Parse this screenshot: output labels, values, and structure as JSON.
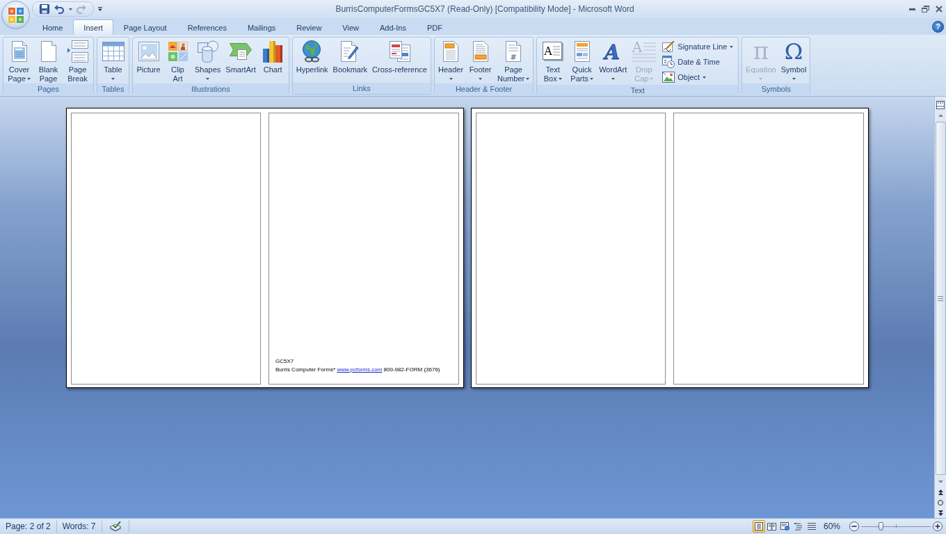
{
  "window": {
    "title": "BurrisComputerFormsGC5X7 (Read-Only) [Compatibility Mode] - Microsoft Word"
  },
  "quick_access": [
    {
      "disabled": false
    },
    {
      "disabled": false
    },
    {
      "disabled": true
    }
  ],
  "tabs": [
    {
      "label": "Home",
      "selected": false
    },
    {
      "label": "Insert",
      "selected": true
    },
    {
      "label": "Page Layout",
      "selected": false
    },
    {
      "label": "References",
      "selected": false
    },
    {
      "label": "Mailings",
      "selected": false
    },
    {
      "label": "Review",
      "selected": false
    },
    {
      "label": "View",
      "selected": false
    },
    {
      "label": "Add-Ins",
      "selected": false
    },
    {
      "label": "PDF",
      "selected": false
    }
  ],
  "help_button": {
    "glyph": "?"
  },
  "ribbon": [
    {
      "label": "Pages",
      "buttons": [
        {
          "kind": "large",
          "lines": [
            "Cover",
            "Page"
          ],
          "dropdown": true,
          "disabled": false
        },
        {
          "kind": "large",
          "lines": [
            "Blank",
            "Page"
          ],
          "dropdown": false,
          "disabled": false
        },
        {
          "kind": "large",
          "lines": [
            "Page",
            "Break"
          ],
          "dropdown": false,
          "disabled": false
        }
      ]
    },
    {
      "label": "Tables",
      "buttons": [
        {
          "kind": "large",
          "lines": [
            "Table"
          ],
          "dropdown": true,
          "disabled": false
        }
      ]
    },
    {
      "label": "Illustrations",
      "buttons": [
        {
          "kind": "large",
          "lines": [
            "Picture"
          ],
          "dropdown": false,
          "disabled": false
        },
        {
          "kind": "large",
          "lines": [
            "Clip",
            "Art"
          ],
          "dropdown": false,
          "disabled": false
        },
        {
          "kind": "large",
          "lines": [
            "Shapes"
          ],
          "dropdown": true,
          "disabled": false
        },
        {
          "kind": "large",
          "lines": [
            "SmartArt"
          ],
          "dropdown": false,
          "disabled": false
        },
        {
          "kind": "large",
          "lines": [
            "Chart"
          ],
          "dropdown": false,
          "disabled": false
        }
      ]
    },
    {
      "label": "Links",
      "buttons": [
        {
          "kind": "large",
          "lines": [
            "Hyperlink"
          ],
          "dropdown": false,
          "disabled": false
        },
        {
          "kind": "large",
          "lines": [
            "Bookmark"
          ],
          "dropdown": false,
          "disabled": false
        },
        {
          "kind": "large",
          "lines": [
            "Cross-reference"
          ],
          "dropdown": false,
          "disabled": false
        }
      ]
    },
    {
      "label": "Header & Footer",
      "buttons": [
        {
          "kind": "large",
          "lines": [
            "Header"
          ],
          "dropdown": true,
          "disabled": false
        },
        {
          "kind": "large",
          "lines": [
            "Footer"
          ],
          "dropdown": true,
          "disabled": false
        },
        {
          "kind": "large",
          "lines": [
            "Page",
            "Number"
          ],
          "dropdown": true,
          "disabled": false,
          "glyph": "#"
        }
      ]
    },
    {
      "label": "Text",
      "buttons": [
        {
          "kind": "large",
          "lines": [
            "Text",
            "Box"
          ],
          "dropdown": true,
          "disabled": false,
          "glyph": "A"
        },
        {
          "kind": "large",
          "lines": [
            "Quick",
            "Parts"
          ],
          "dropdown": true,
          "disabled": false
        },
        {
          "kind": "large",
          "lines": [
            "WordArt"
          ],
          "dropdown": true,
          "disabled": false,
          "glyph": "A"
        },
        {
          "kind": "large",
          "lines": [
            "Drop",
            "Cap"
          ],
          "dropdown": true,
          "disabled": true,
          "glyph": "A"
        },
        {
          "kind": "small",
          "lines": [
            "Signature Line"
          ],
          "dropdown": true,
          "disabled": false
        },
        {
          "kind": "small",
          "lines": [
            "Date & Time"
          ],
          "dropdown": false,
          "disabled": false
        },
        {
          "kind": "small",
          "lines": [
            "Object"
          ],
          "dropdown": true,
          "disabled": false
        }
      ]
    },
    {
      "label": "Symbols",
      "buttons": [
        {
          "kind": "large",
          "lines": [
            "Equation"
          ],
          "dropdown": true,
          "disabled": true,
          "glyph": "π"
        },
        {
          "kind": "large",
          "lines": [
            "Symbol"
          ],
          "dropdown": true,
          "disabled": false,
          "glyph": "Ω"
        }
      ]
    }
  ],
  "pages": [
    {
      "panels": [
        {
          "kind": "blank"
        },
        {
          "kind": "footer",
          "code": "GC5X7",
          "contact": "Burris Computer Forms*",
          "link": "www.pcforms.com",
          "phone": "800-982-FORM (3676)"
        }
      ]
    },
    {
      "panels": [
        {
          "kind": "blank"
        },
        {
          "kind": "blank"
        }
      ]
    }
  ],
  "status_bar": {
    "page": "Page: 2 of 2",
    "words": "Words: 7",
    "views": [
      {
        "selected": true
      },
      {
        "selected": false
      },
      {
        "selected": false
      },
      {
        "selected": false
      },
      {
        "selected": false
      }
    ],
    "zoom": {
      "label": "60%",
      "level": 0.28
    }
  }
}
